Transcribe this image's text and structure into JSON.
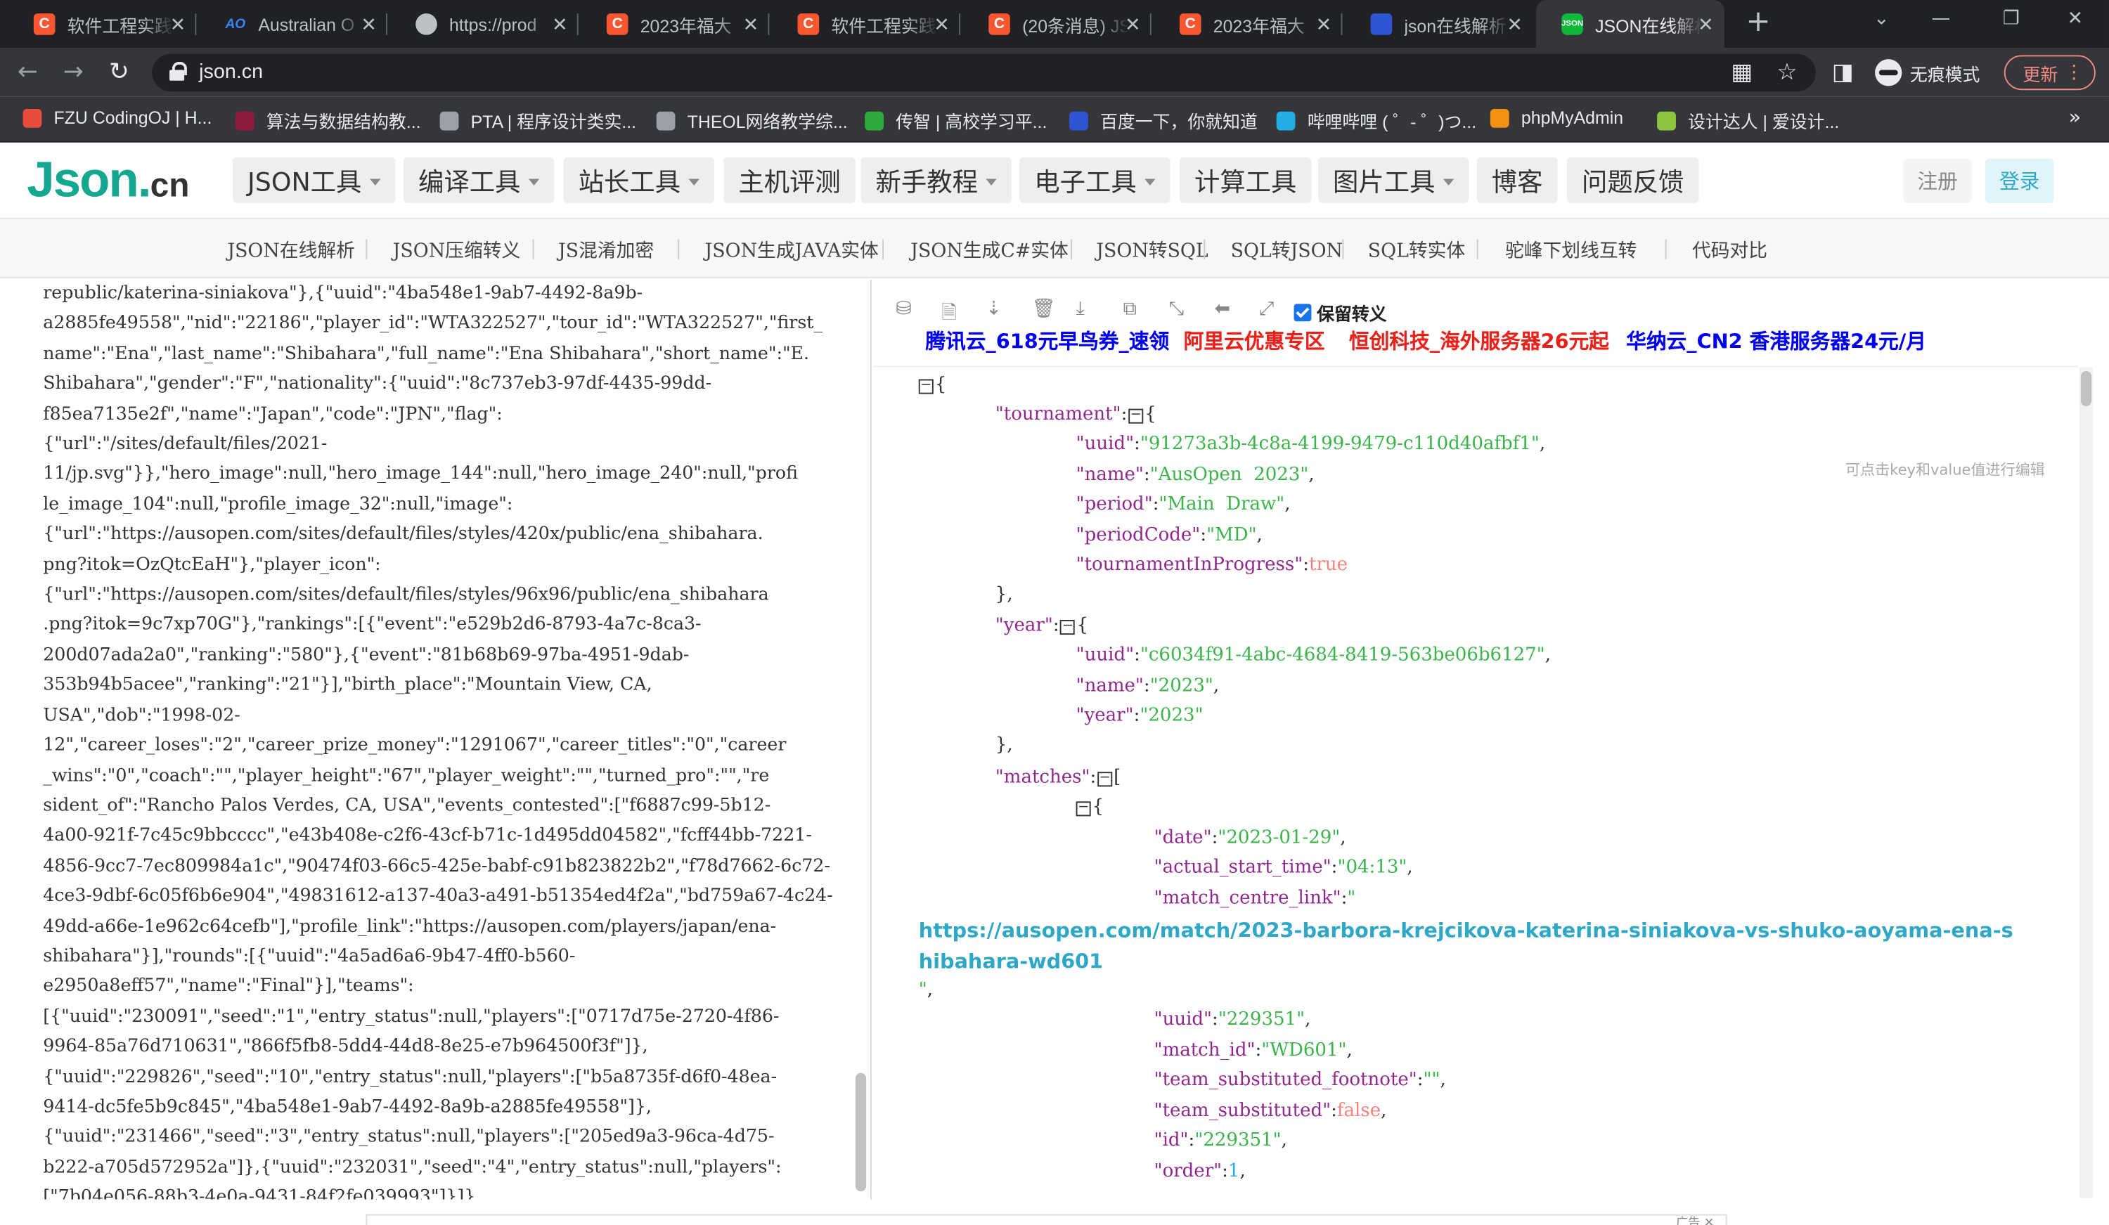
{
  "tabs": [
    {
      "title": "软件工程实践",
      "favicon": "C",
      "icon": "csdn-icon"
    },
    {
      "title": "Australian O",
      "favicon": "AO",
      "icon": "ao-icon"
    },
    {
      "title": "https://prod",
      "favicon": "",
      "icon": "globe-icon"
    },
    {
      "title": "2023年福大",
      "favicon": "C",
      "icon": "csdn-icon"
    },
    {
      "title": "软件工程实践",
      "favicon": "C",
      "icon": "csdn-icon"
    },
    {
      "title": "(20条消息) JS",
      "favicon": "C",
      "icon": "csdn-icon"
    },
    {
      "title": "2023年福大",
      "favicon": "C",
      "icon": "csdn-icon"
    },
    {
      "title": "json在线解析",
      "favicon": "",
      "icon": "paw-icon"
    },
    {
      "title": "JSON在线解析",
      "favicon": "JSON",
      "icon": "json-icon"
    }
  ],
  "browser": {
    "url": "json.cn",
    "incognito_label": "无痕模式",
    "update_label": "更新"
  },
  "bookmarks": [
    {
      "label": "FZU CodingOJ | H...",
      "color": "#e74c3c"
    },
    {
      "label": "算法与数据结构教...",
      "color": "#8e1b3d"
    },
    {
      "label": "PTA | 程序设计类实...",
      "color": "#9aa0a6"
    },
    {
      "label": "THEOL网络教学综...",
      "color": "#9aa0a6"
    },
    {
      "label": "传智 | 高校学习平...",
      "color": "#2eaa3e"
    },
    {
      "label": "百度一下，你就知道",
      "color": "#2f55d4"
    },
    {
      "label": "哔哩哔哩 ( ゜- ゜)つ...",
      "color": "#23ade5"
    },
    {
      "label": "phpMyAdmin",
      "color": "#f29111"
    },
    {
      "label": "设计达人 | 爱设计...",
      "color": "#8cc63f"
    }
  ],
  "site": {
    "logo_main": "Json.",
    "logo_cn": "cn",
    "menus": [
      {
        "label": "JSON工具",
        "caret": true
      },
      {
        "label": "编译工具",
        "caret": true
      },
      {
        "label": "站长工具",
        "caret": true
      },
      {
        "label": "主机评测",
        "caret": false
      },
      {
        "label": "新手教程",
        "caret": true
      },
      {
        "label": "电子工具",
        "caret": true
      },
      {
        "label": "计算工具",
        "caret": false
      },
      {
        "label": "图片工具",
        "caret": true
      },
      {
        "label": "博客",
        "caret": false
      },
      {
        "label": "问题反馈",
        "caret": false
      }
    ],
    "register": "注册",
    "login": "登录",
    "subnav": [
      "JSON在线解析",
      "JSON压缩转义",
      "JS混淆加密",
      "JSON生成JAVA实体",
      "JSON生成C#实体",
      "JSON转SQL",
      "SQL转JSON",
      "SQL转实体",
      "驼峰下划线互转",
      "代码对比"
    ]
  },
  "editor": {
    "raw_text": "republic/katerina-siniakova\"},{\"uuid\":\"4ba548e1-9ab7-4492-8a9b-\na2885fe49558\",\"nid\":\"22186\",\"player_id\":\"WTA322527\",\"tour_id\":\"WTA322527\",\"first_\nname\":\"Ena\",\"last_name\":\"Shibahara\",\"full_name\":\"Ena Shibahara\",\"short_name\":\"E.\nShibahara\",\"gender\":\"F\",\"nationality\":{\"uuid\":\"8c737eb3-97df-4435-99dd-\nf85ea7135e2f\",\"name\":\"Japan\",\"code\":\"JPN\",\"flag\":\n{\"url\":\"/sites/default/files/2021-\n11/jp.svg\"}},\"hero_image\":null,\"hero_image_144\":null,\"hero_image_240\":null,\"profi\nle_image_104\":null,\"profile_image_32\":null,\"image\":\n{\"url\":\"https://ausopen.com/sites/default/files/styles/420x/public/ena_shibahara.\npng?itok=OzQtcEaH\"},\"player_icon\":\n{\"url\":\"https://ausopen.com/sites/default/files/styles/96x96/public/ena_shibahara\n.png?itok=9c7xp70G\"},\"rankings\":[{\"event\":\"e529b2d6-8793-4a7c-8ca3-\n200d07ada2a0\",\"ranking\":\"580\"},{\"event\":\"81b68b69-97ba-4951-9dab-\n353b94b5acee\",\"ranking\":\"21\"}],\"birth_place\":\"Mountain View, CA,\nUSA\",\"dob\":\"1998-02-\n12\",\"career_loses\":\"2\",\"career_prize_money\":\"1291067\",\"career_titles\":\"0\",\"career\n_wins\":\"0\",\"coach\":\"\",\"player_height\":\"67\",\"player_weight\":\"\",\"turned_pro\":\"\",\"re\nsident_of\":\"Rancho Palos Verdes, CA, USA\",\"events_contested\":[\"f6887c99-5b12-\n4a00-921f-7c45c9bbcccc\",\"e43b408e-c2f6-43cf-b71c-1d495dd04582\",\"fcff44bb-7221-\n4856-9cc7-7ec809984a1c\",\"90474f03-66c5-425e-babf-c91b823822b2\",\"f78d7662-6c72-\n4ce3-9dbf-6c05f6b6e904\",\"49831612-a137-40a3-a491-b51354ed4f2a\",\"bd759a67-4c24-\n49dd-a66e-1e962c64cefb\"],\"profile_link\":\"https://ausopen.com/players/japan/ena-\nshibahara\"}],\"rounds\":[{\"uuid\":\"4a5ad6a6-9b47-4ff0-b560-\ne2950a8eff57\",\"name\":\"Final\"}],\"teams\":\n[{\"uuid\":\"230091\",\"seed\":\"1\",\"entry_status\":null,\"players\":[\"0717d75e-2720-4f86-\n9964-85a76d710631\",\"866f5fb8-5dd4-44d8-8e25-e7b964500f3f\"]},\n{\"uuid\":\"229826\",\"seed\":\"10\",\"entry_status\":null,\"players\":[\"b5a8735f-d6f0-48ea-\n9414-dc5fe5b9c845\",\"4ba548e1-9ab7-4492-8a9b-a2885fe49558\"]},\n{\"uuid\":\"231466\",\"seed\":\"3\",\"entry_status\":null,\"players\":[\"205ed9a3-96ca-4d75-\nb222-a705d572952a\"]},{\"uuid\":\"232031\",\"seed\":\"4\",\"entry_status\":null,\"players\":\n[\"7b04e056-88b3-4e0a-9431-84f2fe039993\"]}]}"
  },
  "viewer": {
    "keep_escape_label": "保留转义",
    "keep_escape_checked": true,
    "toolbar_icons": [
      "database-icon",
      "excel-icon",
      "sort-icon",
      "trash-icon",
      "download-icon",
      "copy-icon",
      "compress-icon",
      "back-icon",
      "expand-icon"
    ],
    "ads": [
      {
        "label": "腾讯云_618元早鸟券_速领",
        "color": "#0000ee"
      },
      {
        "label": "阿里云优惠专区",
        "color": "#e8221a"
      },
      {
        "label": "恒创科技_海外服务器26元起",
        "color": "#e8221a"
      },
      {
        "label": "华纳云_CN2 香港服务器24元/月",
        "color": "#0000ee"
      }
    ],
    "edit_hint": "可点击key和value值进行编辑",
    "tournament": {
      "uuid": "91273a3b-4c8a-4199-9479-c110d40afbf1",
      "name": "AusOpen  2023",
      "period": "Main  Draw",
      "periodCode": "MD",
      "tournamentInProgress": "true"
    },
    "year": {
      "uuid": "c6034f91-4abc-4684-8419-563be06b6127",
      "name": "2023",
      "year": "2023"
    },
    "match": {
      "date": "2023-01-29",
      "actual_start_time": "04:13",
      "match_centre_link": "https://ausopen.com/match/2023-barbora-krejcikova-katerina-siniakova-vs-shuko-aoyama-ena-shibahara-wd601",
      "uuid": "229351",
      "match_id": "WD601",
      "team_substituted_footnote": "",
      "team_substituted": "false",
      "id": "229351",
      "order": "1"
    },
    "keys": {
      "tournament": "tournament",
      "uuid": "uuid",
      "name": "name",
      "period": "period",
      "periodCode": "periodCode",
      "tournamentInProgress": "tournamentInProgress",
      "year": "year",
      "matches": "matches",
      "date": "date",
      "actual_start_time": "actual_start_time",
      "match_centre_link": "match_centre_link",
      "match_id": "match_id",
      "team_substituted_footnote": "team_substituted_footnote",
      "team_substituted": "team_substituted",
      "id": "id",
      "order": "order"
    }
  },
  "footer": {
    "ad_label": "广告 ✕"
  }
}
